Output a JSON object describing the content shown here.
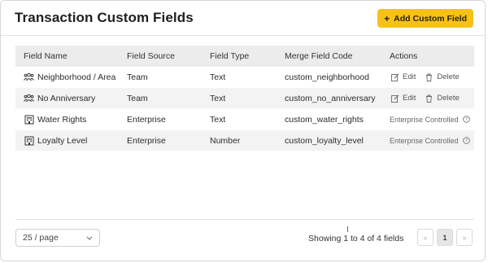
{
  "header": {
    "title": "Transaction Custom Fields",
    "add_button_label": "Add Custom Field",
    "add_button_icon": "plus-icon",
    "accent_color": "#f6c21a"
  },
  "table": {
    "columns": [
      "Field Name",
      "Field Source",
      "Field Type",
      "Merge Field Code",
      "Actions"
    ],
    "rows": [
      {
        "icon": "team-icon",
        "name": "Neighborhood / Area",
        "source": "Team",
        "type": "Text",
        "code": "custom_neighborhood",
        "edit": "Edit",
        "delete": "Delete"
      },
      {
        "icon": "team-icon",
        "name": "No Anniversary",
        "source": "Team",
        "type": "Text",
        "code": "custom_no_anniversary",
        "edit": "Edit",
        "delete": "Delete"
      },
      {
        "icon": "building-icon",
        "name": "Water Rights",
        "source": "Enterprise",
        "type": "Text",
        "code": "custom_water_rights",
        "status": "Enterprise Controlled"
      },
      {
        "icon": "building-icon",
        "name": "Loyalty Level",
        "source": "Enterprise",
        "type": "Number",
        "code": "custom_loyalty_level",
        "status": "Enterprise Controlled"
      }
    ]
  },
  "footer": {
    "page_size": "25 / page",
    "showing_text": "Showing 1 to 4 of 4 fields",
    "prev_label": "«",
    "current_page": "1",
    "next_label": "»"
  }
}
